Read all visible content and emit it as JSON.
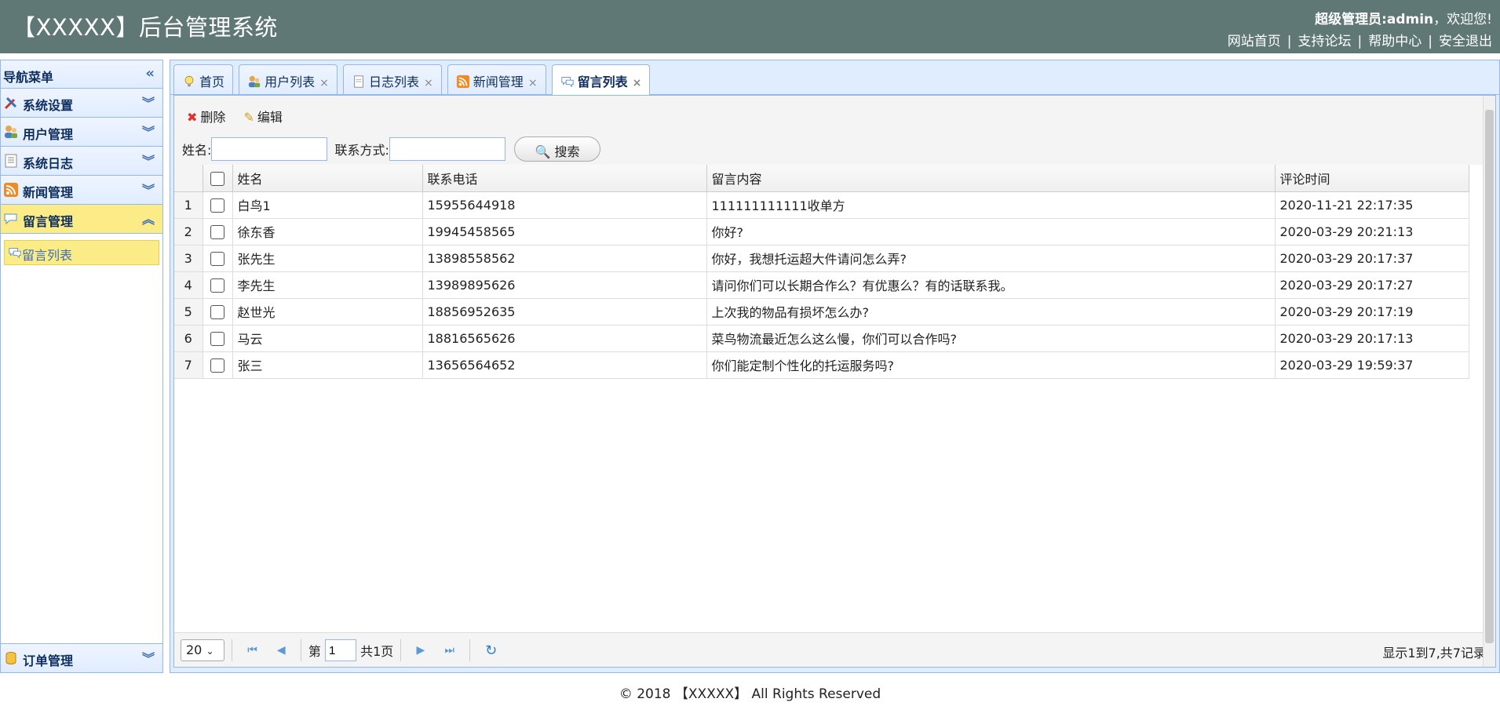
{
  "header": {
    "title": "【XXXXX】后台管理系统",
    "welcome_prefix": "超级管理员:admin",
    "welcome_suffix": "，欢迎您!",
    "links": [
      "网站首页",
      "支持论坛",
      "帮助中心",
      "安全退出"
    ]
  },
  "sidebar": {
    "title": "导航菜单",
    "items": [
      {
        "label": "系统设置",
        "icon": "settings-icon"
      },
      {
        "label": "用户管理",
        "icon": "users-icon"
      },
      {
        "label": "系统日志",
        "icon": "log-icon"
      },
      {
        "label": "新闻管理",
        "icon": "rss-icon"
      },
      {
        "label": "留言管理",
        "icon": "comment-icon"
      }
    ],
    "sub_items": [
      {
        "label": "留言列表",
        "icon": "comment-icon"
      }
    ],
    "bottom_item": {
      "label": "订单管理",
      "icon": "database-icon"
    }
  },
  "tabs": [
    {
      "label": "首页",
      "icon": "lightbulb-icon"
    },
    {
      "label": "用户列表",
      "icon": "users-icon"
    },
    {
      "label": "日志列表",
      "icon": "document-icon"
    },
    {
      "label": "新闻管理",
      "icon": "rss-icon"
    },
    {
      "label": "留言列表",
      "icon": "comment-icon"
    }
  ],
  "toolbar": {
    "delete_label": "删除",
    "edit_label": "编辑"
  },
  "search": {
    "name_label": "姓名:",
    "contact_label": "联系方式:",
    "button_label": "搜索"
  },
  "table": {
    "columns": [
      "姓名",
      "联系电话",
      "留言内容",
      "评论时间"
    ],
    "rows": [
      {
        "num": "1",
        "name": "白鸟1",
        "phone": "15955644918",
        "message": "111111111111收单方",
        "time": "2020-11-21 22:17:35"
      },
      {
        "num": "2",
        "name": "徐东香",
        "phone": "19945458565",
        "message": "你好?",
        "time": "2020-03-29 20:21:13"
      },
      {
        "num": "3",
        "name": "张先生",
        "phone": "13898558562",
        "message": "你好，我想托运超大件请问怎么弄?",
        "time": "2020-03-29 20:17:37"
      },
      {
        "num": "4",
        "name": "李先生",
        "phone": "13989895626",
        "message": "请问你们可以长期合作么？有优惠么？有的话联系我。",
        "time": "2020-03-29 20:17:27"
      },
      {
        "num": "5",
        "name": "赵世光",
        "phone": "18856952635",
        "message": "上次我的物品有损坏怎么办?",
        "time": "2020-03-29 20:17:19"
      },
      {
        "num": "6",
        "name": "马云",
        "phone": "18816565626",
        "message": "菜鸟物流最近怎么这么慢，你们可以合作吗?",
        "time": "2020-03-29 20:17:13"
      },
      {
        "num": "7",
        "name": "张三",
        "phone": "13656564652",
        "message": "你们能定制个性化的托运服务吗?",
        "time": "2020-03-29 19:59:37"
      }
    ]
  },
  "pager": {
    "page_size": "20",
    "page_prefix": "第",
    "current_page": "1",
    "page_suffix": "共1页",
    "info": "显示1到7,共7记录"
  },
  "footer": "© 2018 【XXXXX】 All Rights Reserved"
}
